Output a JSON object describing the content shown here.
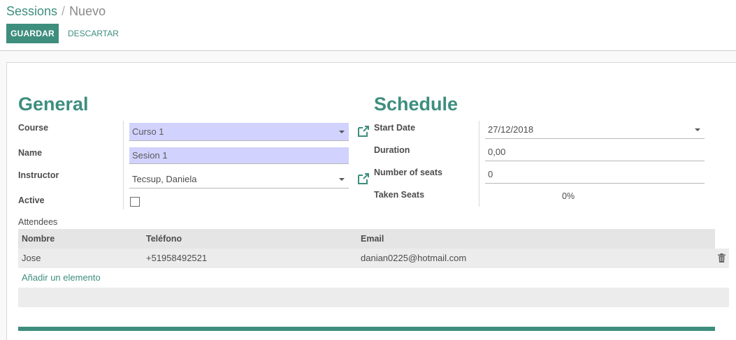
{
  "breadcrumb": {
    "parent": "Sessions",
    "separator": "/",
    "current": "Nuevo"
  },
  "actions": {
    "save": "GUARDAR",
    "discard": "DESCARTAR"
  },
  "general": {
    "title": "General",
    "course": {
      "label": "Course",
      "value": "Curso 1"
    },
    "name": {
      "label": "Name",
      "value": "Sesion 1"
    },
    "instructor": {
      "label": "Instructor",
      "value": "Tecsup, Daniela"
    },
    "active": {
      "label": "Active",
      "checked": false
    }
  },
  "schedule": {
    "title": "Schedule",
    "start_date": {
      "label": "Start Date",
      "value": "27/12/2018"
    },
    "duration": {
      "label": "Duration",
      "value": "0,00"
    },
    "seats": {
      "label": "Number of seats",
      "value": "0"
    },
    "taken": {
      "label": "Taken Seats",
      "value": "0%"
    }
  },
  "attendees": {
    "label": "Attendees",
    "columns": [
      "Nombre",
      "Teléfono",
      "Email"
    ],
    "rows": [
      {
        "nombre": "Jose",
        "telefono": "+51958492521",
        "email": "danian0225@hotmail.com"
      }
    ],
    "add_label": "Añadir un elemento"
  },
  "colors": {
    "accent": "#3e8e7e",
    "required_bg": "#d2d2ff"
  },
  "icons": {
    "external": "external-link-icon",
    "trash": "trash-icon",
    "dropdown": "caret-down-icon"
  }
}
